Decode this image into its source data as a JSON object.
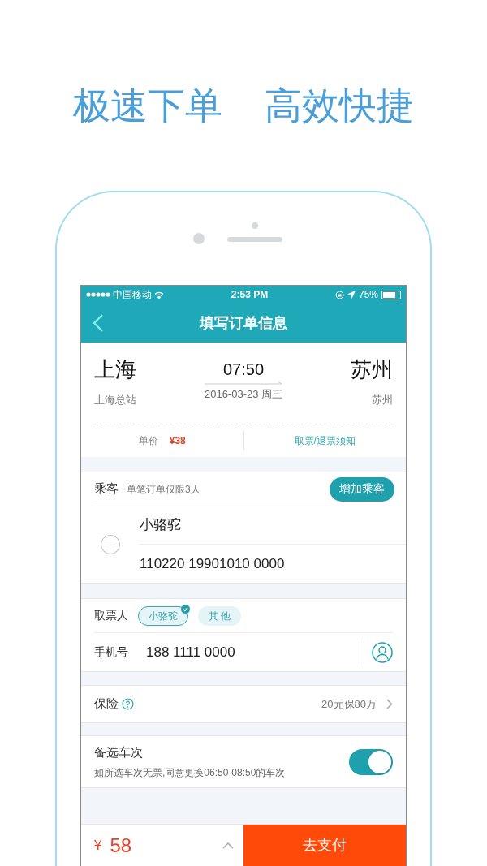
{
  "headline": [
    "极速下单",
    "高效快捷"
  ],
  "status_bar": {
    "carrier": "中国移动",
    "time": "2:53 PM",
    "battery": "75%"
  },
  "nav": {
    "title": "填写订单信息"
  },
  "trip": {
    "from_city": "上海",
    "from_station": "上海总站",
    "time": "07:50",
    "date": "2016-03-23 周三",
    "to_city": "苏州",
    "to_station": "苏州"
  },
  "price_row": {
    "label": "单价",
    "price": "¥38",
    "notice_link": "取票/退票须知"
  },
  "passengers": {
    "label": "乘客",
    "note": "单笔订单仅限3人",
    "add_button": "增加乘客",
    "items": [
      {
        "name": "小骆驼",
        "id_number": "110220 19901010 0000"
      }
    ]
  },
  "pickup": {
    "label": "取票人",
    "options": [
      {
        "label": "小骆驼",
        "selected": true
      },
      {
        "label": "其 他",
        "selected": false
      }
    ]
  },
  "phone": {
    "label": "手机号",
    "value": "188 1111 0000"
  },
  "insurance": {
    "label": "保险",
    "value": "20元保80万"
  },
  "backup": {
    "title": "备选车次",
    "description": "如所选车次无票,同意更换06:50-08:50的车次",
    "on": true
  },
  "bottom": {
    "currency": "¥",
    "amount": "58",
    "pay_button": "去支付"
  }
}
